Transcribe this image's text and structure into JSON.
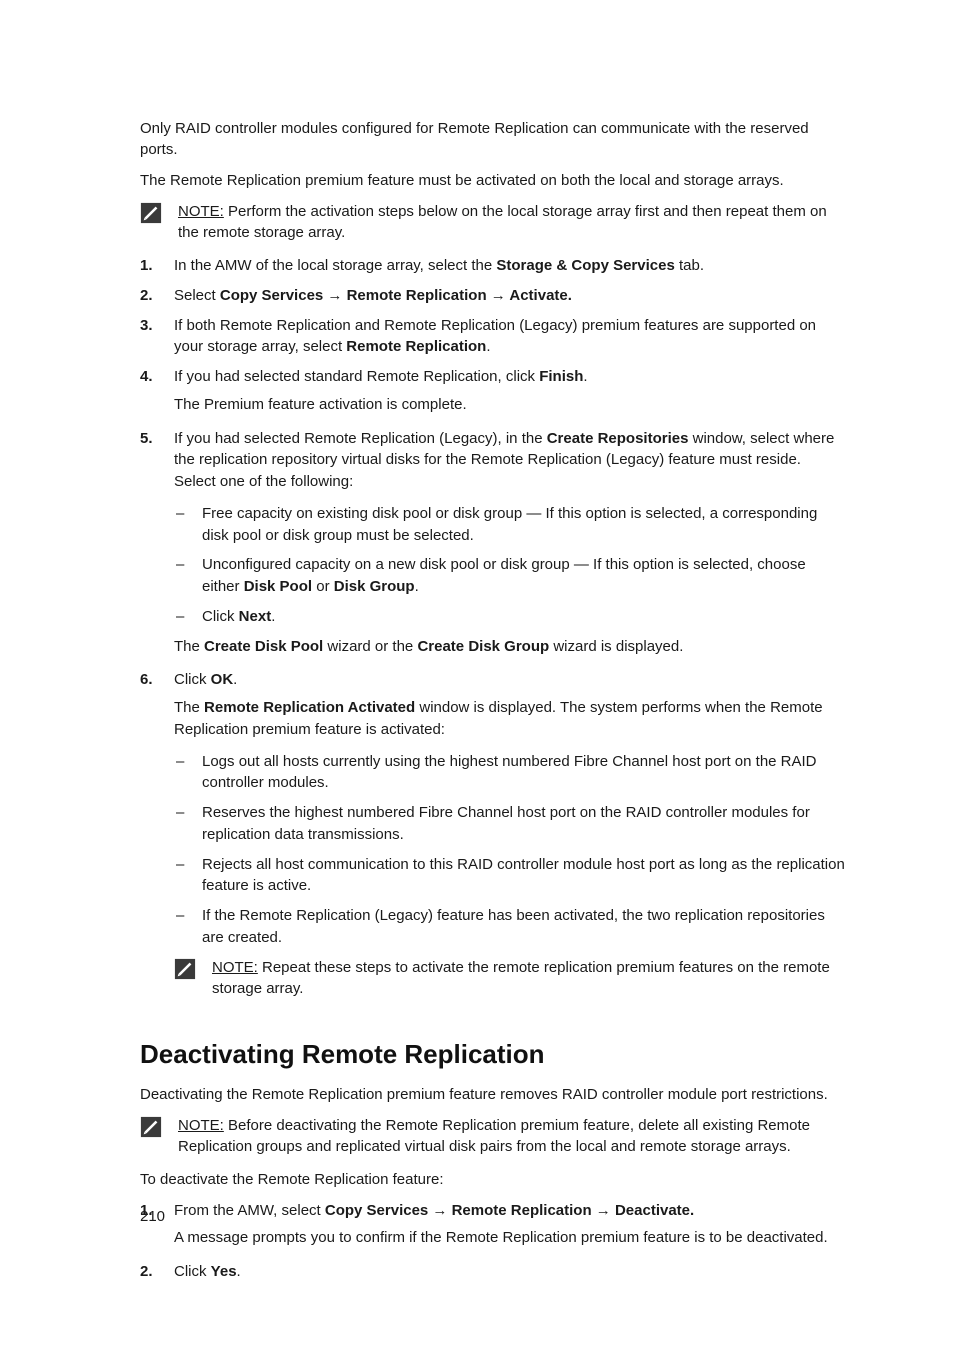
{
  "intro": {
    "p1": "Only RAID controller modules configured for Remote Replication can communicate with the reserved ports.",
    "p2": "The Remote Replication premium feature must be activated on both the local and storage arrays."
  },
  "note1": {
    "label": "NOTE:",
    "text": " Perform the activation steps below on the local storage array first and then repeat them on the remote storage array."
  },
  "steps": {
    "s1": {
      "num": "1.",
      "pre": "In the AMW of the local storage array, select the ",
      "bold": "Storage & Copy Services",
      "post": " tab."
    },
    "s2": {
      "num": "2.",
      "pre": "Select ",
      "bold": "Copy Services → Remote Replication → Activate."
    },
    "s3": {
      "num": "3.",
      "pre": "If both Remote Replication and Remote Replication (Legacy) premium features are supported on your storage array, select ",
      "bold": "Remote Replication",
      "post": "."
    },
    "s4": {
      "num": "4.",
      "pre": "If you had selected standard Remote Replication, click ",
      "bold": "Finish",
      "post": ".",
      "extra": "The Premium feature activation is complete."
    },
    "s5": {
      "num": "5.",
      "pre": "If you had selected Remote Replication (Legacy), in the ",
      "bold": "Create Repositories",
      "post": " window, select where the replication repository virtual disks for the Remote Replication (Legacy) feature must reside. Select one of the following:",
      "sub": {
        "a": "Free capacity on existing disk pool or disk group — If this option is selected, a corresponding disk pool or disk group must be selected.",
        "b_pre": "Unconfigured capacity on a new disk pool or disk group — If this option is selected, choose either ",
        "b_b1": "Disk Pool",
        "b_mid": " or ",
        "b_b2": "Disk Group",
        "b_post": ".",
        "c_pre": "Click ",
        "c_bold": "Next",
        "c_post": "."
      },
      "after_pre": "The ",
      "after_b1": "Create Disk Pool",
      "after_mid": " wizard or the ",
      "after_b2": "Create Disk Group",
      "after_post": " wizard is displayed."
    },
    "s6": {
      "num": "6.",
      "pre": "Click ",
      "bold": "OK",
      "post": ".",
      "extra_pre": "The ",
      "extra_b": "Remote Replication Activated",
      "extra_post": " window is displayed. The system performs when the Remote Replication premium feature is activated:",
      "sub": {
        "a": "Logs out all hosts currently using the highest numbered Fibre Channel host port on the RAID controller modules.",
        "b": "Reserves the highest numbered Fibre Channel host port on the RAID controller modules for replication data transmissions.",
        "c": "Rejects all host communication to this RAID controller module host port as long as the replication feature is active.",
        "d": "If the Remote Replication (Legacy) feature has been activated, the two replication repositories are created."
      }
    }
  },
  "note2": {
    "label": "NOTE:",
    "text": " Repeat these steps to activate the remote replication premium features on the remote storage array."
  },
  "section2": {
    "heading": "Deactivating Remote Replication",
    "p1": "Deactivating the Remote Replication premium feature removes RAID controller module port restrictions.",
    "note": {
      "label": "NOTE:",
      "text": " Before deactivating the Remote Replication premium feature, delete all existing Remote Replication groups and replicated virtual disk pairs from the local and remote storage arrays."
    },
    "p2": "To deactivate the Remote Replication feature:",
    "s1": {
      "num": "1.",
      "pre": "From the AMW, select ",
      "bold": "Copy Services → Remote Replication → Deactivate.",
      "extra": "A message prompts you to confirm if the Remote Replication premium feature is to be deactivated."
    },
    "s2": {
      "num": "2.",
      "pre": "Click ",
      "bold": "Yes",
      "post": "."
    }
  },
  "page_number": "210",
  "dash": "–"
}
